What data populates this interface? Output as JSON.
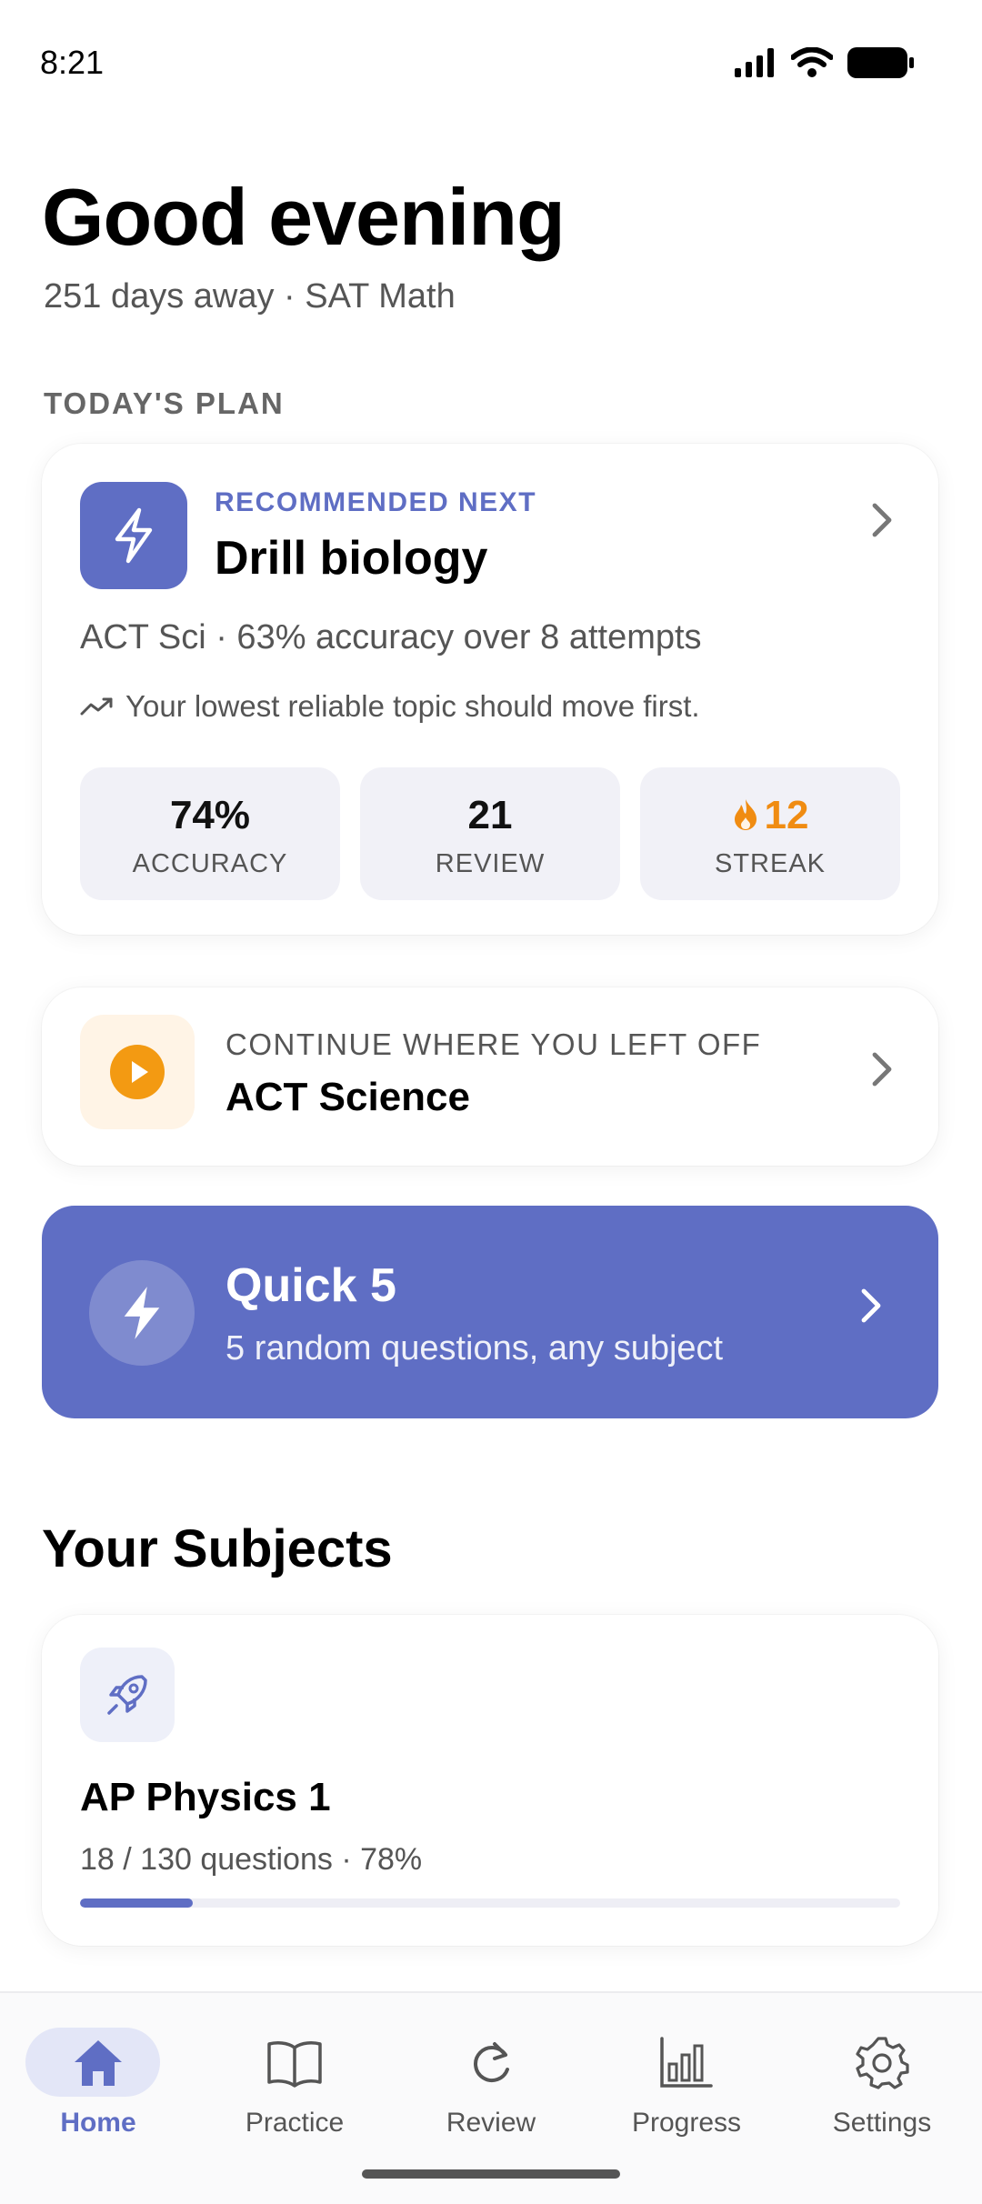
{
  "status_bar": {
    "time": "8:21"
  },
  "header": {
    "greeting": "Good evening",
    "subline": "251 days away · SAT Math"
  },
  "todays_plan": {
    "section_label": "TODAY'S PLAN",
    "kicker": "RECOMMENDED NEXT",
    "title": "Drill biology",
    "description": "ACT Sci · 63% accuracy over 8 attempts",
    "hint": "Your lowest reliable topic should move first.",
    "stats": [
      {
        "value": "74%",
        "label": "ACCURACY"
      },
      {
        "value": "21",
        "label": "REVIEW"
      },
      {
        "value": "12",
        "label": "STREAK"
      }
    ]
  },
  "continue": {
    "kicker": "CONTINUE WHERE YOU LEFT OFF",
    "title": "ACT Science"
  },
  "quick5": {
    "title": "Quick 5",
    "subtitle": "5 random questions, any subject"
  },
  "subjects": {
    "title": "Your Subjects",
    "items": [
      {
        "name": "AP Physics 1",
        "meta": "18 / 130 questions · 78%",
        "progress": 0.138,
        "icon": "rocket-icon"
      }
    ]
  },
  "nav": {
    "items": [
      {
        "label": "Home",
        "icon": "home-icon",
        "active": true
      },
      {
        "label": "Practice",
        "icon": "book-icon",
        "active": false
      },
      {
        "label": "Review",
        "icon": "refresh-icon",
        "active": false
      },
      {
        "label": "Progress",
        "icon": "bar-chart-icon",
        "active": false
      },
      {
        "label": "Settings",
        "icon": "gear-icon",
        "active": false
      }
    ]
  },
  "colors": {
    "accent": "#5f6ec4",
    "streak": "#f08c12",
    "continue_icon_bg": "#fff4e6"
  }
}
